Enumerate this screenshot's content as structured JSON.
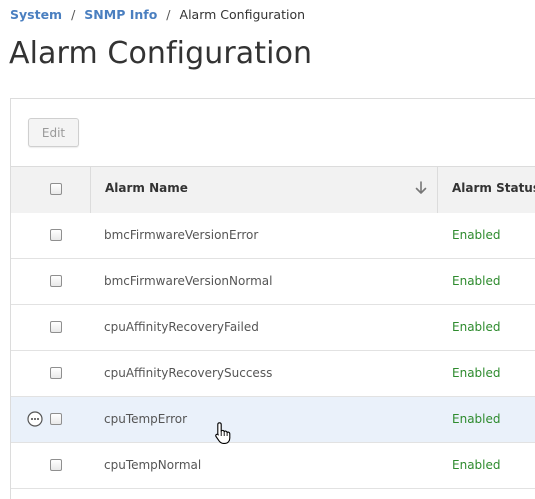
{
  "breadcrumb": {
    "items": [
      {
        "label": "System"
      },
      {
        "label": "SNMP Info"
      },
      {
        "label": "Alarm Configuration"
      }
    ],
    "separator": "/"
  },
  "page": {
    "title": "Alarm Configuration"
  },
  "toolbar": {
    "edit_label": "Edit"
  },
  "table": {
    "columns": {
      "name": "Alarm Name",
      "status": "Alarm Status"
    },
    "sort": {
      "column": "name",
      "direction": "descending",
      "icon": "arrow-down-icon"
    },
    "rows": [
      {
        "name": "bmcFirmwareVersionError",
        "status": "Enabled"
      },
      {
        "name": "bmcFirmwareVersionNormal",
        "status": "Enabled"
      },
      {
        "name": "cpuAffinityRecoveryFailed",
        "status": "Enabled"
      },
      {
        "name": "cpuAffinityRecoverySuccess",
        "status": "Enabled"
      },
      {
        "name": "cpuTempError",
        "status": "Enabled",
        "hovered": true
      },
      {
        "name": "cpuTempNormal",
        "status": "Enabled"
      }
    ]
  },
  "colors": {
    "link": "#4a7fc0",
    "status_enabled": "#2e8b2e",
    "row_hover": "#eaf1fa",
    "header_bg": "#f2f2f2"
  }
}
